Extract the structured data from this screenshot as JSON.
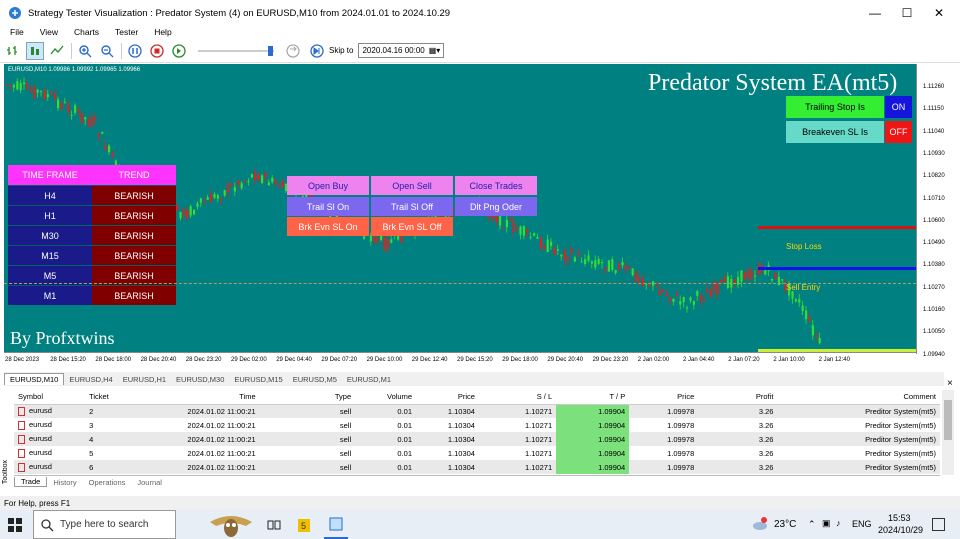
{
  "window": {
    "title": "Strategy Tester Visualization : Predator System (4) on EURUSD,M10 from 2024.01.01 to 2024.10.29"
  },
  "menu": [
    "File",
    "View",
    "Charts",
    "Tester",
    "Help"
  ],
  "toolbar": {
    "skip_label": "Skip to",
    "skip_value": "2020.04.16 00:00"
  },
  "chart": {
    "header": "EURUSD,M10  1.09986 1.09992 1.09965 1.09966",
    "ea_title": "Predator System EA(mt5)",
    "by_label": "By Profxtwins",
    "trailing_stop_label": "Trailing Stop Is",
    "trailing_stop_value": "ON",
    "breakeven_label": "Breakeven SL Is",
    "breakeven_value": "OFF",
    "trend_table": {
      "headers": [
        "TIME FRAME",
        "TREND"
      ],
      "rows": [
        [
          "H4",
          "BEARISH"
        ],
        [
          "H1",
          "BEARISH"
        ],
        [
          "M30",
          "BEARISH"
        ],
        [
          "M15",
          "BEARISH"
        ],
        [
          "M5",
          "BEARISH"
        ],
        [
          "M1",
          "BEARISH"
        ]
      ]
    },
    "buttons": {
      "open_buy": "Open Buy",
      "open_sell": "Open Sell",
      "close_trades": "Close Trades",
      "trail_on": "Trail Sl On",
      "trail_off": "Trail Sl Off",
      "dlt_png": "Dlt Png Oder",
      "brk_on": "Brk Evn SL On",
      "brk_off": "Brk Evn SL Off"
    },
    "stop_loss_label": "Stop Loss",
    "sell_entry_label": "Sell Entry",
    "price_labels": [
      "1.11260",
      "1.11150",
      "1.11040",
      "1.10930",
      "1.10820",
      "1.10710",
      "1.10600",
      "1.10490",
      "1.10380",
      "1.10270",
      "1.10160",
      "1.10050",
      "1.09940"
    ],
    "time_labels": [
      "28 Dec 2023",
      "28 Dec 15:20",
      "28 Dec 18:00",
      "28 Dec 20:40",
      "28 Dec 23:20",
      "29 Dec 02:00",
      "29 Dec 04:40",
      "29 Dec 07:20",
      "29 Dec 10:00",
      "29 Dec 12:40",
      "29 Dec 15:20",
      "29 Dec 18:00",
      "29 Dec 20:40",
      "29 Dec 23:20",
      "2 Jan 02:00",
      "2 Jan 04:40",
      "2 Jan 07:20",
      "2 Jan 10:00",
      "2 Jan 12:40"
    ]
  },
  "symbol_tabs": [
    "EURUSD,M10",
    "EURUSD,H4",
    "EURUSD,H1",
    "EURUSD,M30",
    "EURUSD,M15",
    "EURUSD,M5",
    "EURUSD,M1"
  ],
  "trades": {
    "columns": [
      "Symbol",
      "Ticket",
      "Time",
      "Type",
      "Volume",
      "Price",
      "S / L",
      "T / P",
      "Price",
      "Profit",
      "Comment"
    ],
    "rows": [
      [
        "eurusd",
        "2",
        "2024.01.02 11:00:21",
        "sell",
        "0.01",
        "1.10304",
        "1.10271",
        "1.09904",
        "1.09978",
        "3.26",
        "Preditor System(mt5)"
      ],
      [
        "eurusd",
        "3",
        "2024.01.02 11:00:21",
        "sell",
        "0.01",
        "1.10304",
        "1.10271",
        "1.09904",
        "1.09978",
        "3.26",
        "Preditor System(mt5)"
      ],
      [
        "eurusd",
        "4",
        "2024.01.02 11:00:21",
        "sell",
        "0.01",
        "1.10304",
        "1.10271",
        "1.09904",
        "1.09978",
        "3.26",
        "Preditor System(mt5)"
      ],
      [
        "eurusd",
        "5",
        "2024.01.02 11:00:21",
        "sell",
        "0.01",
        "1.10304",
        "1.10271",
        "1.09904",
        "1.09978",
        "3.26",
        "Preditor System(mt5)"
      ],
      [
        "eurusd",
        "6",
        "2024.01.02 11:00:21",
        "sell",
        "0.01",
        "1.10304",
        "1.10271",
        "1.09904",
        "1.09978",
        "3.26",
        "Preditor System(mt5)"
      ]
    ]
  },
  "bottom_tabs": [
    "Trade",
    "History",
    "Operations",
    "Journal"
  ],
  "toolbox_label": "Toolbox",
  "status": "For Help, press F1",
  "taskbar": {
    "search_placeholder": "Type here to search",
    "temperature": "23°C",
    "lang": "ENG",
    "time": "15:53",
    "date": "2024/10/29"
  }
}
